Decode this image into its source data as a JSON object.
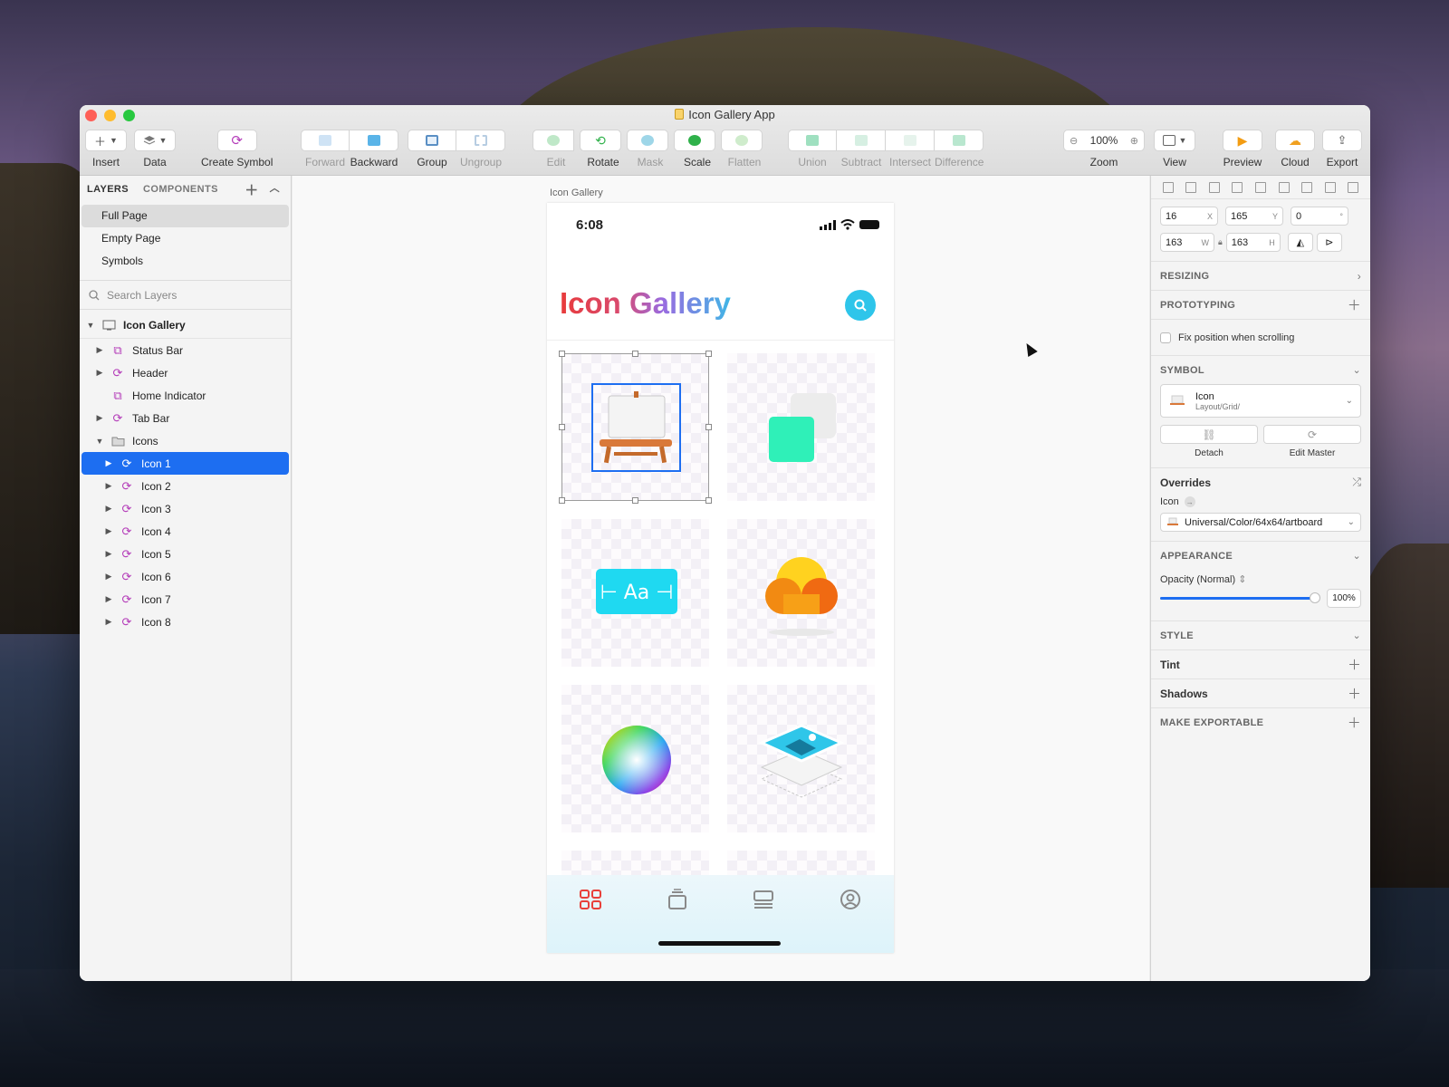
{
  "window": {
    "title": "Icon Gallery App"
  },
  "toolbar": {
    "insert": "Insert",
    "data": "Data",
    "create_symbol": "Create Symbol",
    "forward": "Forward",
    "backward": "Backward",
    "group": "Group",
    "ungroup": "Ungroup",
    "edit": "Edit",
    "rotate": "Rotate",
    "mask": "Mask",
    "scale": "Scale",
    "flatten": "Flatten",
    "union": "Union",
    "subtract": "Subtract",
    "intersect": "Intersect",
    "difference": "Difference",
    "zoom_label": "Zoom",
    "zoom_value": "100%",
    "view": "View",
    "preview": "Preview",
    "cloud": "Cloud",
    "export": "Export"
  },
  "left_panel": {
    "tab_layers": "LAYERS",
    "tab_components": "COMPONENTS",
    "pages": [
      "Full Page",
      "Empty Page",
      "Symbols"
    ],
    "selected_page": "Full Page",
    "search_placeholder": "Search Layers",
    "artboard": "Icon Gallery",
    "layers": [
      {
        "name": "Status Bar",
        "type": "symbol-instance"
      },
      {
        "name": "Header",
        "type": "symbol"
      },
      {
        "name": "Home Indicator",
        "type": "symbol-instance"
      },
      {
        "name": "Tab Bar",
        "type": "symbol"
      },
      {
        "name": "Icons",
        "type": "group"
      }
    ],
    "icon_layers": [
      "Icon 1",
      "Icon 2",
      "Icon 3",
      "Icon 4",
      "Icon 5",
      "Icon 6",
      "Icon 7",
      "Icon 8"
    ],
    "selected_layer": "Icon 1"
  },
  "canvas": {
    "artboard_label": "Icon Gallery",
    "status_time": "6:08",
    "app_title": "Icon Gallery",
    "text_icon_label": "⊢ Aa ⊣"
  },
  "inspector": {
    "x": "16",
    "x_suffix": "X",
    "y": "165",
    "y_suffix": "Y",
    "rotation": "0",
    "rotation_suffix": "°",
    "w": "163",
    "w_suffix": "W",
    "h": "163",
    "h_suffix": "H",
    "resizing": "RESIZING",
    "prototyping": "PROTOTYPING",
    "fix_position": "Fix position when scrolling",
    "symbol": "SYMBOL",
    "symbol_name": "Icon",
    "symbol_path": "Layout/Grid/",
    "detach": "Detach",
    "edit_master": "Edit Master",
    "overrides": "Overrides",
    "override_icon_label": "Icon",
    "override_value": "Universal/Color/64x64/artboard",
    "appearance": "APPEARANCE",
    "opacity_label": "Opacity (Normal)",
    "opacity_value": "100%",
    "opacity_fraction": 0.97,
    "style": "STYLE",
    "tint": "Tint",
    "shadows": "Shadows",
    "make_exportable": "MAKE EXPORTABLE"
  },
  "colors": {
    "selection_blue": "#1d6ef1",
    "symbol_purple": "#b43cb9",
    "accent_cyan": "#2ec5ea"
  }
}
